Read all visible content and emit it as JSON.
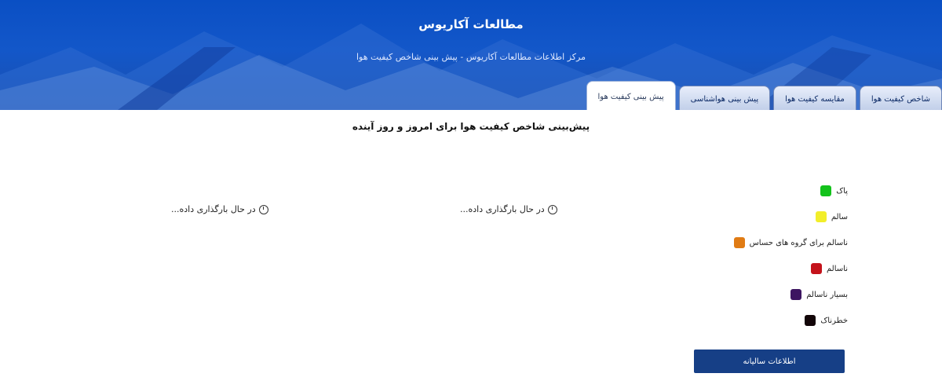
{
  "header": {
    "title": "مطالعات آکاریوس",
    "subtitle": "مرکز اطلاعات مطالعات آکاریوس - پیش بینی شاخص کیفیت هوا"
  },
  "tabs": [
    {
      "label": "شاخص کیفیت هوا",
      "active": false
    },
    {
      "label": "مقایسه کیفیت هوا",
      "active": false
    },
    {
      "label": "پیش بینی هواشناسی",
      "active": false
    },
    {
      "label": "پیش بینی کیفیت هوا",
      "active": true
    }
  ],
  "main": {
    "heading": "پیش‌بینی شاخص کیفیت هوا برای امروز و روز آینده",
    "panels": [
      {
        "status": "در حال بارگذاری داده..."
      },
      {
        "status": "در حال بارگذاری داده..."
      }
    ]
  },
  "legend": [
    {
      "label": "پاک",
      "color": "#13c21b"
    },
    {
      "label": "سالم",
      "color": "#f2ee2a"
    },
    {
      "label": "ناسالم برای گروه های حساس",
      "color": "#e07b14"
    },
    {
      "label": "ناسالم",
      "color": "#c4131b"
    },
    {
      "label": "بسیار ناسالم",
      "color": "#3d1561"
    },
    {
      "label": "خطرناک",
      "color": "#120508"
    }
  ],
  "archive_button": "اطلاعات سالیانه"
}
